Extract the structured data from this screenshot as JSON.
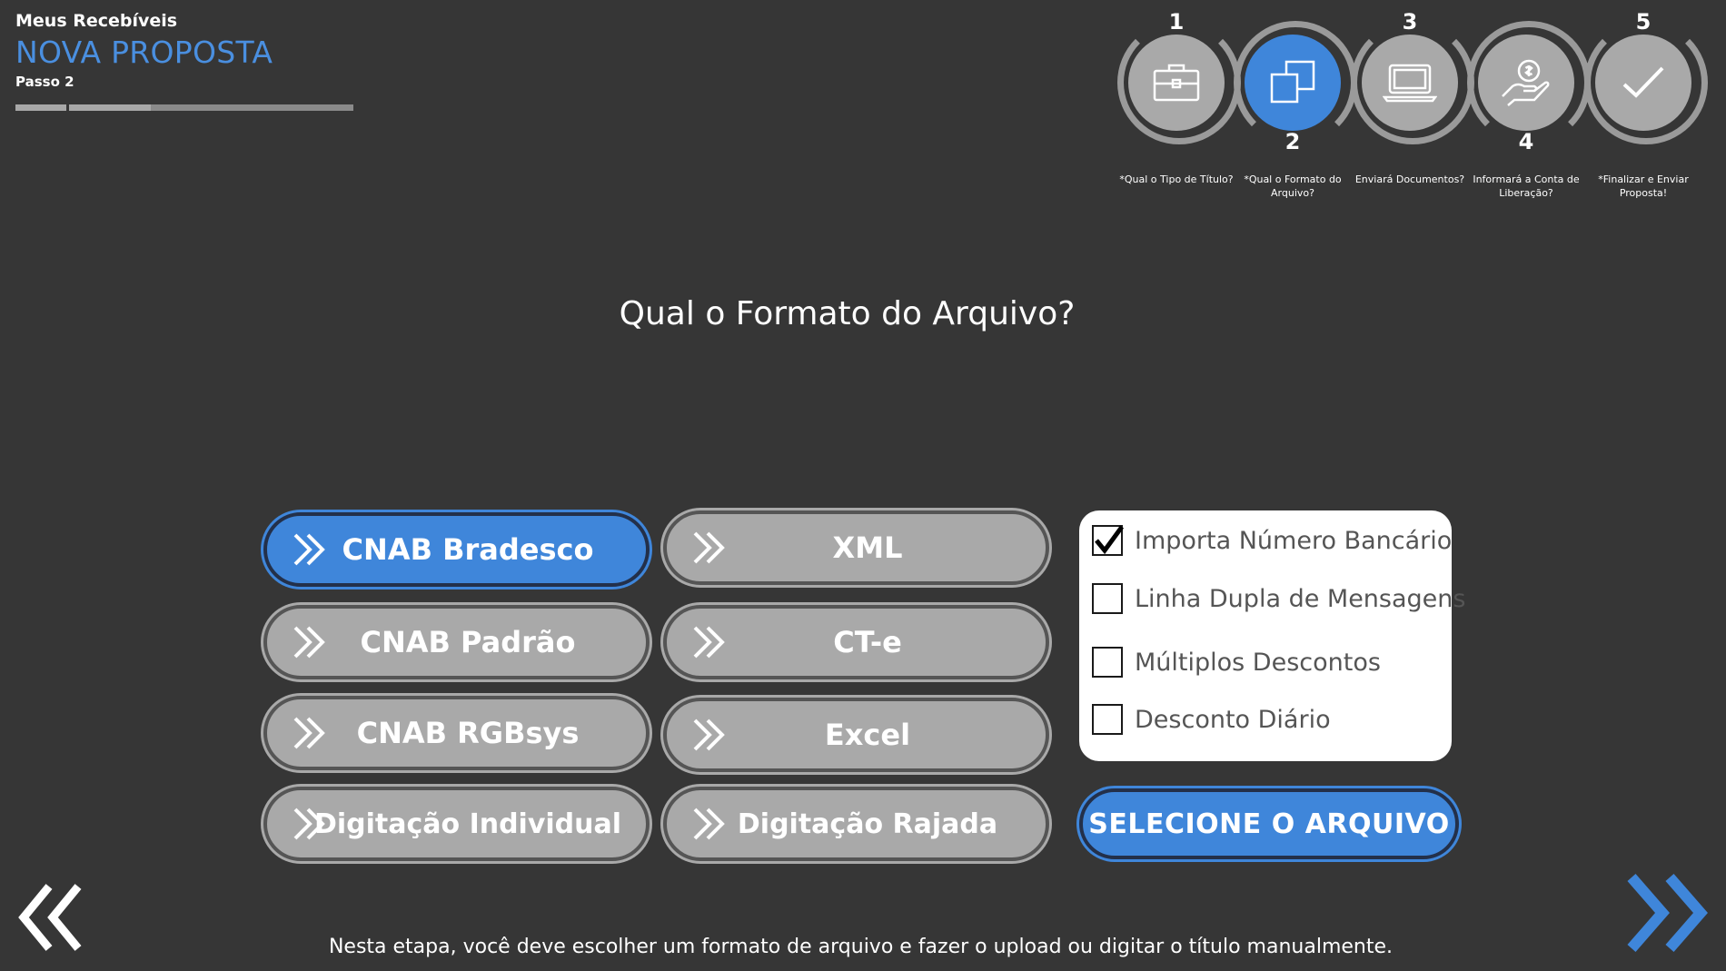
{
  "header": {
    "app_title": "Meus Recebíveis",
    "page_title": "NOVA PROPOSTA",
    "step_label": "Passo 2",
    "progress_fraction": 0.4
  },
  "stepper": {
    "steps": [
      {
        "number": "1",
        "caption": "*Qual o Tipo de Título?",
        "icon": "briefcase-icon",
        "active": false
      },
      {
        "number": "2",
        "caption": "*Qual o Formato do Arquivo?",
        "icon": "copy-icon",
        "active": true
      },
      {
        "number": "3",
        "caption": "Enviará Documentos?",
        "icon": "laptop-icon",
        "active": false
      },
      {
        "number": "4",
        "caption": "Informará a Conta de Liberação?",
        "icon": "money-hand-icon",
        "active": false
      },
      {
        "number": "5",
        "caption": "*Finalizar e Enviar Proposta!",
        "icon": "check-icon",
        "active": false
      }
    ]
  },
  "question": "Qual o Formato do Arquivo?",
  "formats": [
    {
      "label": "CNAB Bradesco",
      "selected": true
    },
    {
      "label": "XML",
      "selected": false
    },
    {
      "label": "CNAB Padrão",
      "selected": false
    },
    {
      "label": "CT-e",
      "selected": false
    },
    {
      "label": "CNAB RGBsys",
      "selected": false
    },
    {
      "label": "Excel",
      "selected": false
    },
    {
      "label": "Digitação Individual",
      "selected": false
    },
    {
      "label": "Digitação Rajada",
      "selected": false
    }
  ],
  "options": [
    {
      "label": "Importa Número Bancário",
      "checked": true
    },
    {
      "label": "Linha Dupla de Mensagens",
      "checked": false
    },
    {
      "label": "Múltiplos Descontos",
      "checked": false
    },
    {
      "label": "Desconto Diário",
      "checked": false
    }
  ],
  "select_file_label": "SELECIONE O ARQUIVO",
  "footer_text": "Nesta etapa, você deve escolher um formato de arquivo e fazer o upload ou digitar o título manualmente.",
  "colors": {
    "accent": "#3f86da",
    "button_grey": "#a9a9a9",
    "background": "#363636",
    "title_blue": "#4a8fe0"
  }
}
